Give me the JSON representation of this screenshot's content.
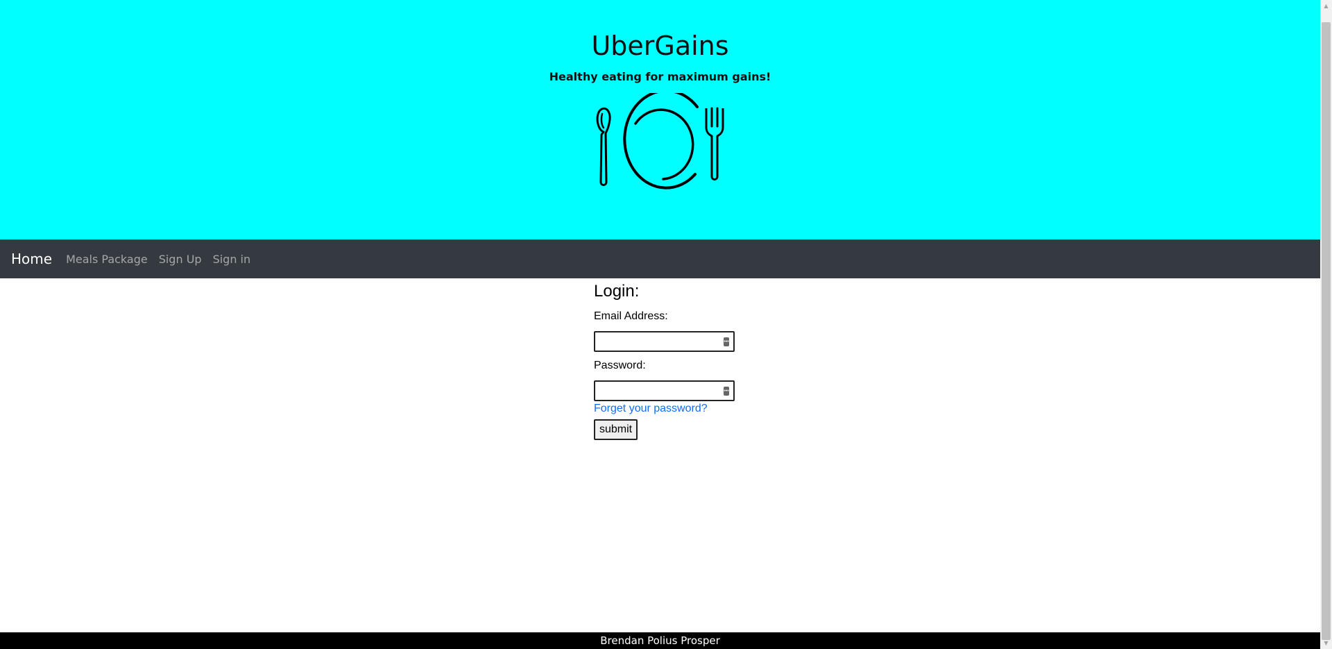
{
  "hero": {
    "title": "UberGains",
    "subtitle": "Healthy eating for maximum gains!",
    "logo_icon": "plate-fork-spoon-icon",
    "background": "#00ffff"
  },
  "nav": {
    "brand": "Home",
    "links": [
      "Meals Package",
      "Sign Up",
      "Sign in"
    ],
    "background": "#343a40"
  },
  "login": {
    "title": "Login:",
    "email_label": "Email Address:",
    "email_value": "",
    "password_label": "Password:",
    "password_value": "",
    "forgot_label": "Forget your password?",
    "submit_label": "submit",
    "link_color": "#0d6efd"
  },
  "footer": {
    "text": "Brendan Polius Prosper"
  }
}
